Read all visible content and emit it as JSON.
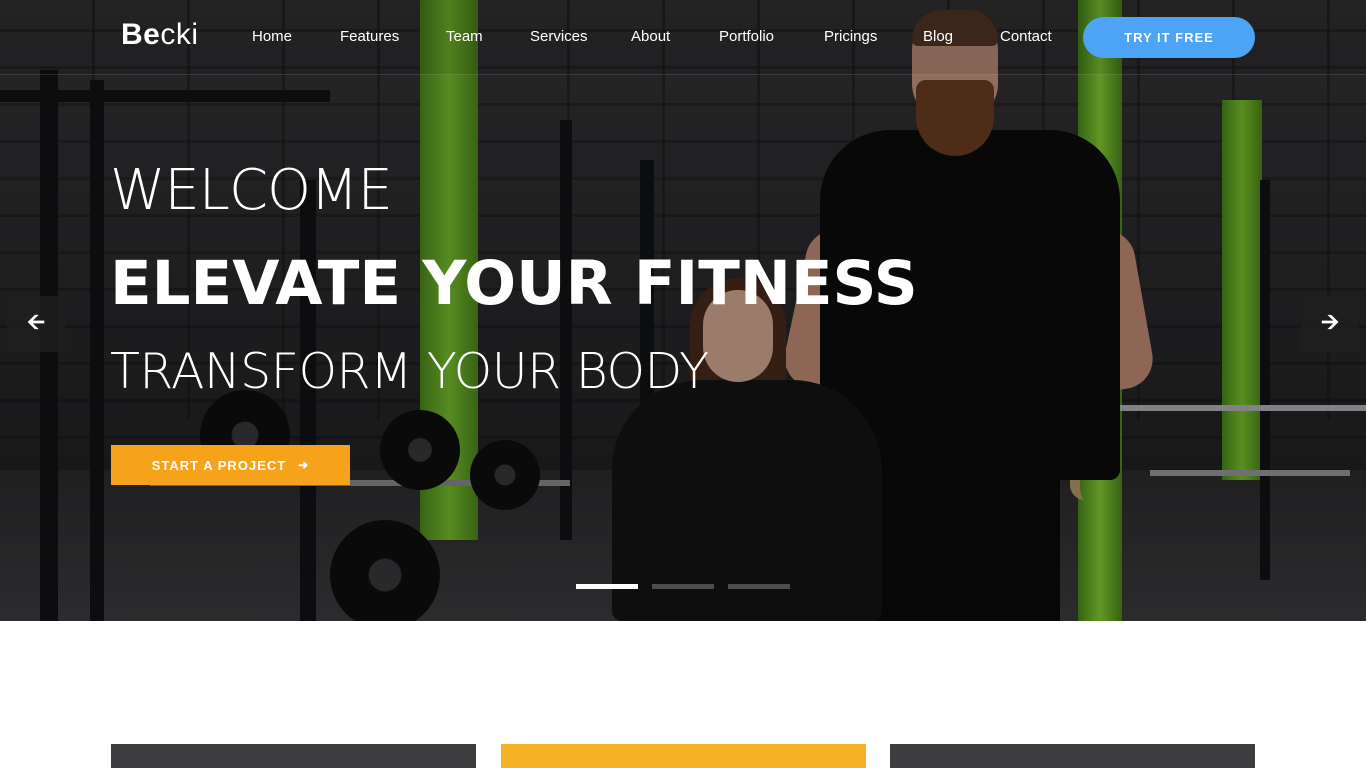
{
  "brand": {
    "logo_part1": "Be",
    "logo_part2": "cki"
  },
  "nav": {
    "items": [
      {
        "label": "Home"
      },
      {
        "label": "Features"
      },
      {
        "label": "Team"
      },
      {
        "label": "Services"
      },
      {
        "label": "About"
      },
      {
        "label": "Portfolio"
      },
      {
        "label": "Pricings"
      },
      {
        "label": "Blog"
      },
      {
        "label": "Contact"
      }
    ],
    "cta_label": "TRY IT FREE"
  },
  "hero": {
    "welcome": "WELCOME",
    "headline": "ELEVATE YOUR FITNESS",
    "subline": "TRANSFORM YOUR BODY",
    "cta_label": "START A PROJECT",
    "cta_icon": "arrow-right-icon",
    "prev_icon": "arrow-left-icon",
    "next_icon": "arrow-right-icon",
    "slides_total": 3,
    "active_slide": 1
  },
  "colors": {
    "cta_orange": "#f7a21b",
    "try_blue": "#4da3f5",
    "card_dark": "#3d3d3f",
    "card_yellow": "#f7b125",
    "accent_green": "#79c22f"
  }
}
